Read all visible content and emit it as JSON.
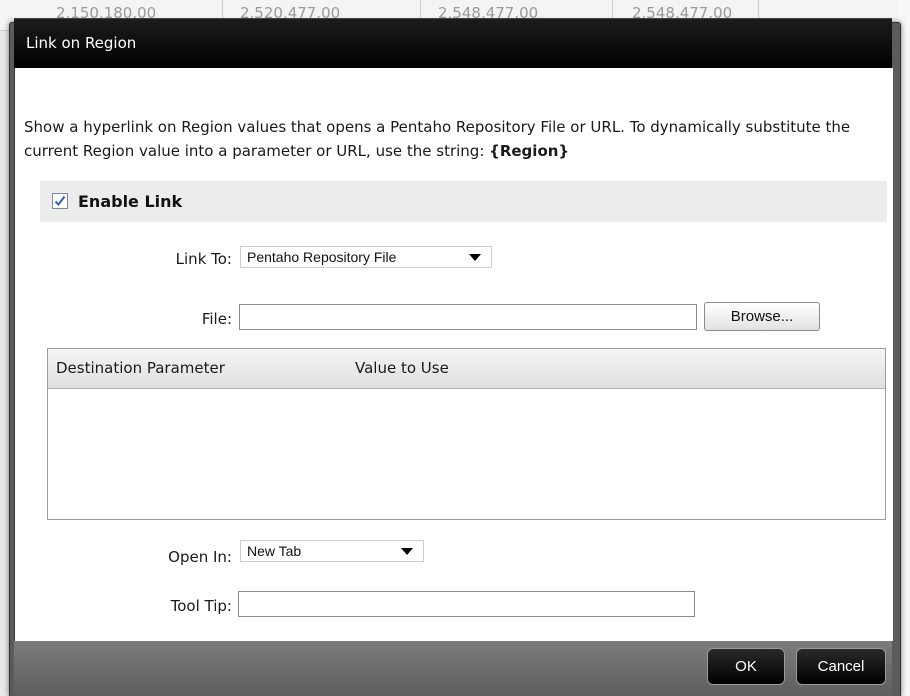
{
  "background": {
    "cells": [
      "2,150,180.00",
      "2,520,477.00",
      "2,548,477.00",
      "2,548,477.00"
    ]
  },
  "dialog": {
    "title": "Link on Region",
    "description_prefix": "Show a hyperlink on Region values that opens a Pentaho Repository File or URL. To dynamically substitute the current Region value into a parameter or URL, use the string: ",
    "description_token": "{Region}",
    "enable_link": {
      "label": "Enable Link",
      "checked": true
    },
    "link_to": {
      "label": "Link To:",
      "value": "Pentaho Repository File"
    },
    "file": {
      "label": "File:",
      "value": "",
      "browse_label": "Browse..."
    },
    "parameters_table": {
      "columns": [
        "Destination Parameter",
        "Value to Use"
      ],
      "rows": []
    },
    "open_in": {
      "label": "Open In:",
      "value": "New Tab"
    },
    "tool_tip": {
      "label": "Tool Tip:",
      "value": ""
    },
    "buttons": {
      "ok": "OK",
      "cancel": "Cancel"
    }
  },
  "colors": {
    "titlebar": "#000000",
    "dialog_frame": "#5b5b5b",
    "enable_row": "#ececec",
    "checkmark": "#3b5db0"
  }
}
